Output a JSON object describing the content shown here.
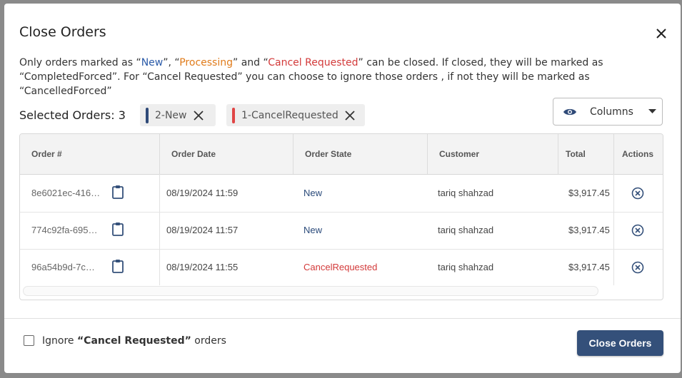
{
  "dialog": {
    "title": "Close Orders",
    "desc": {
      "p1": "Only orders marked as “",
      "new": "New",
      "p2": "”, “",
      "processing": "Processing",
      "p3": "” and “",
      "cancel": "Cancel Requested",
      "p4": "” can be closed. If closed, they will be marked as “CompletedForced”. For “Cancel Requested” you can choose to ignore those orders , if not they will be marked as “CancelledForced”"
    },
    "selected_label": "Selected Orders: 3",
    "chips": [
      {
        "label": "2-New",
        "color": "#2f4a78"
      },
      {
        "label": "1-CancelRequested",
        "color": "#e04545"
      }
    ],
    "columns_button": "Columns",
    "table": {
      "headers": [
        "Order #",
        "Order Date",
        "Order State",
        "Customer",
        "Total",
        "Actions"
      ],
      "rows": [
        {
          "id": "8e6021ec-416…",
          "date": "08/19/2024 11:59",
          "state": "New",
          "customer": "tariq shahzad",
          "total": "$3,917.45"
        },
        {
          "id": "774c92fa-695…",
          "date": "08/19/2024 11:57",
          "state": "New",
          "customer": "tariq shahzad",
          "total": "$3,917.45"
        },
        {
          "id": "96a54b9d-7c…",
          "date": "08/19/2024 11:55",
          "state": "CancelRequested",
          "customer": "tariq shahzad",
          "total": "$3,917.45"
        }
      ]
    },
    "footer": {
      "ignore_prefix": "Ignore ",
      "ignore_bold": "“Cancel Requested”",
      "ignore_suffix": " orders",
      "ignore_checked": false,
      "primary_button": "Close Orders"
    },
    "colors": {
      "new": "#2a5aa8",
      "processing": "#e07b1a",
      "cancel": "#d33a3a",
      "primary": "#34507a"
    }
  }
}
